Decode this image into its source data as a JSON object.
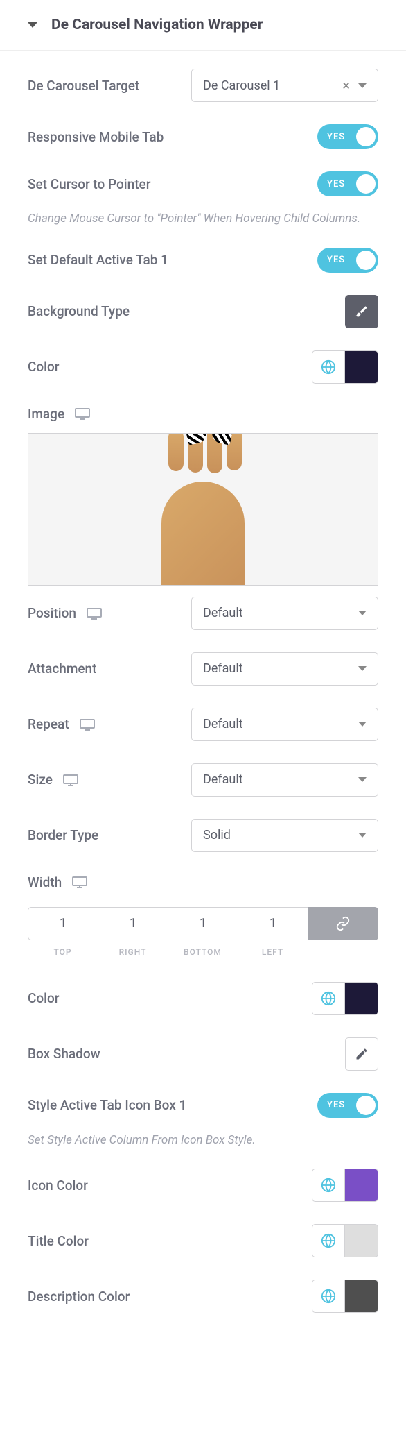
{
  "header": {
    "title": "De Carousel Navigation Wrapper"
  },
  "target": {
    "label": "De Carousel Target",
    "value": "De Carousel 1"
  },
  "responsive_tab": {
    "label": "Responsive Mobile Tab",
    "state": "YES"
  },
  "cursor": {
    "label": "Set Cursor to Pointer",
    "state": "YES",
    "hint": "Change Mouse Cursor to \"Pointer\" When Hovering Child Columns."
  },
  "default_active": {
    "label": "Set Default Active Tab 1",
    "state": "YES"
  },
  "bg_type": {
    "label": "Background Type"
  },
  "color1": {
    "label": "Color",
    "value": "#1d1938"
  },
  "image": {
    "label": "Image"
  },
  "position": {
    "label": "Position",
    "value": "Default"
  },
  "attachment": {
    "label": "Attachment",
    "value": "Default"
  },
  "repeat": {
    "label": "Repeat",
    "value": "Default"
  },
  "size": {
    "label": "Size",
    "value": "Default"
  },
  "border_type": {
    "label": "Border Type",
    "value": "Solid"
  },
  "width": {
    "label": "Width",
    "top": "1",
    "right": "1",
    "bottom": "1",
    "left": "1",
    "labels": {
      "top": "TOP",
      "right": "RIGHT",
      "bottom": "BOTTOM",
      "left": "LEFT"
    }
  },
  "color2": {
    "label": "Color",
    "value": "#1d1938"
  },
  "box_shadow": {
    "label": "Box Shadow"
  },
  "style_active": {
    "label": "Style Active Tab Icon Box 1",
    "state": "YES",
    "hint": "Set Style Active Column From Icon Box Style."
  },
  "icon_color": {
    "label": "Icon Color",
    "value": "#7a4fc6"
  },
  "title_color": {
    "label": "Title Color",
    "value": "#dedede"
  },
  "desc_color": {
    "label": "Description Color",
    "value": "#4f4f4f"
  }
}
